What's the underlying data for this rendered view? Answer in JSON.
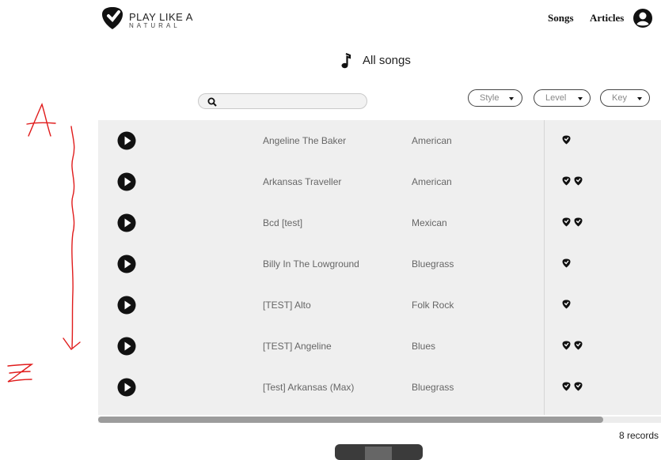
{
  "header": {
    "logo_line1": "PLAY LIKE A",
    "logo_line2": "NATURAL",
    "nav": {
      "songs": "Songs",
      "articles": "Articles"
    },
    "user_icon": "user-circle-icon"
  },
  "page": {
    "title": "All songs",
    "title_icon": "music-note-icon"
  },
  "search": {
    "placeholder": "",
    "value": "",
    "icon": "search-icon"
  },
  "filters": {
    "style": "Style",
    "level": "Level",
    "key": "Key"
  },
  "songs": [
    {
      "name": "Angeline The Baker",
      "style": "American",
      "level": 1
    },
    {
      "name": "Arkansas Traveller",
      "style": "American",
      "level": 2
    },
    {
      "name": "Bcd [test]",
      "style": "Mexican",
      "level": 2
    },
    {
      "name": "Billy In The Lowground",
      "style": "Bluegrass",
      "level": 1
    },
    {
      "name": "[TEST] Alto",
      "style": "Folk Rock",
      "level": 1
    },
    {
      "name": "[TEST] Angeline",
      "style": "Blues",
      "level": 2
    },
    {
      "name": "[Test] Arkansas (Max)",
      "style": "Bluegrass",
      "level": 2
    }
  ],
  "footer": {
    "records": "8 records"
  },
  "annotations": {
    "top_letter": "A",
    "bottom_letter": "Z",
    "color": "#e01b1b"
  },
  "colors": {
    "row_bg": "#efefef",
    "text_gray": "#666666",
    "dark": "#111111"
  }
}
